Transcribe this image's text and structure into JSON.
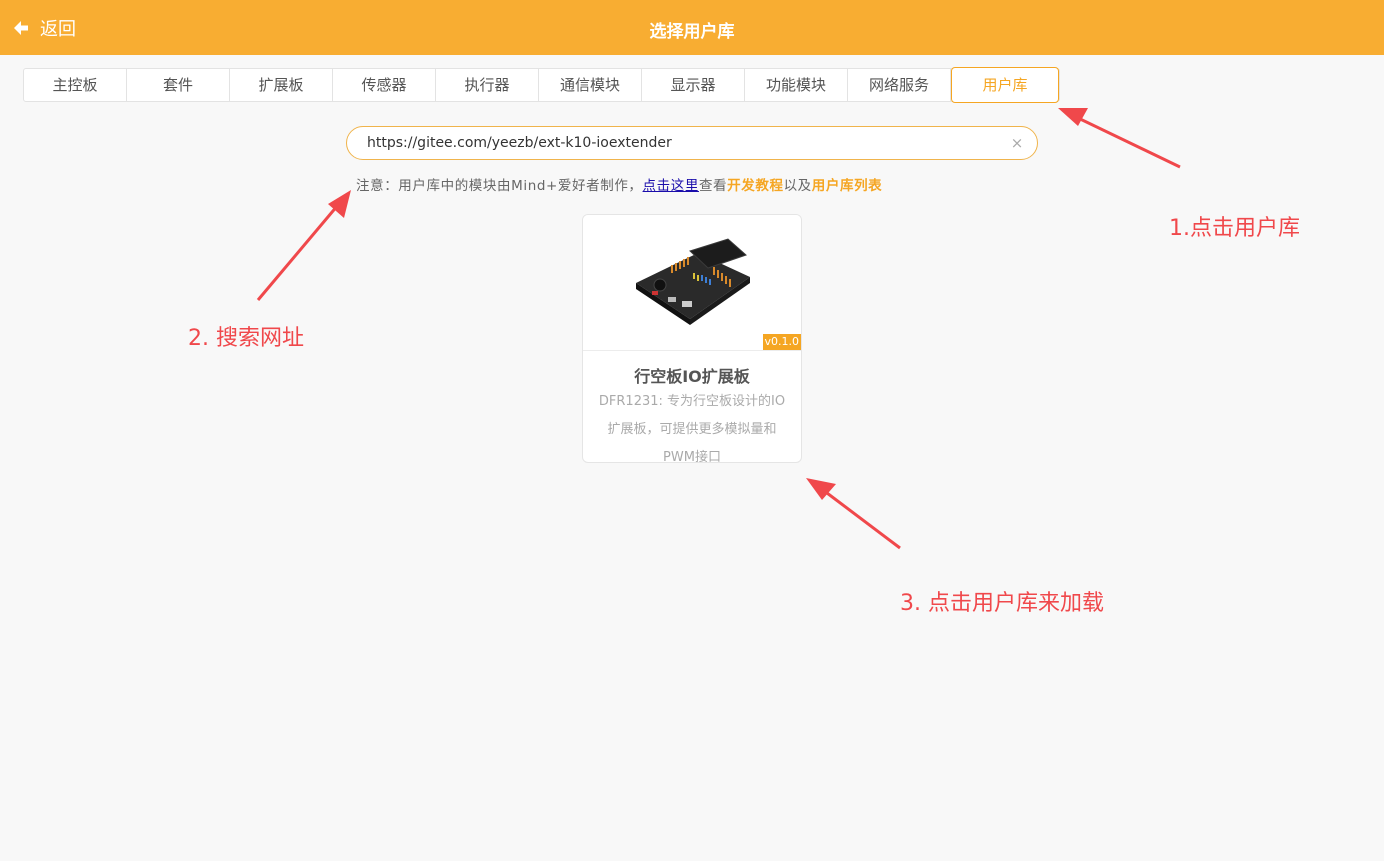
{
  "header": {
    "back_label": "返回",
    "title": "选择用户库"
  },
  "tabs": [
    {
      "label": "主控板"
    },
    {
      "label": "套件"
    },
    {
      "label": "扩展板"
    },
    {
      "label": "传感器"
    },
    {
      "label": "执行器"
    },
    {
      "label": "通信模块"
    },
    {
      "label": "显示器"
    },
    {
      "label": "功能模块"
    },
    {
      "label": "网络服务"
    },
    {
      "label": "用户库",
      "active": true
    }
  ],
  "search": {
    "value": "https://gitee.com/yeezb/ext-k10-ioextender",
    "clear_symbol": "×"
  },
  "notice": {
    "prefix": "注意：用户库中的模块由Mind+爱好者制作，",
    "link": "点击这里",
    "middle": "查看",
    "tutorial": "开发教程",
    "and": "以及",
    "list": "用户库列表"
  },
  "card": {
    "version": "v0.1.0",
    "title": "行空板IO扩展板",
    "description": "DFR1231: 专为行空板设计的IO扩展板，可提供更多模拟量和PWM接口"
  },
  "annotations": {
    "step1": "1.点击用户库",
    "step2": "2. 搜索网址",
    "step3": "3. 点击用户库来加载"
  },
  "colors": {
    "header_bg": "#f8ad32",
    "accent": "#f5a623",
    "annotation": "#f0484b",
    "link": "#1a0dab"
  }
}
